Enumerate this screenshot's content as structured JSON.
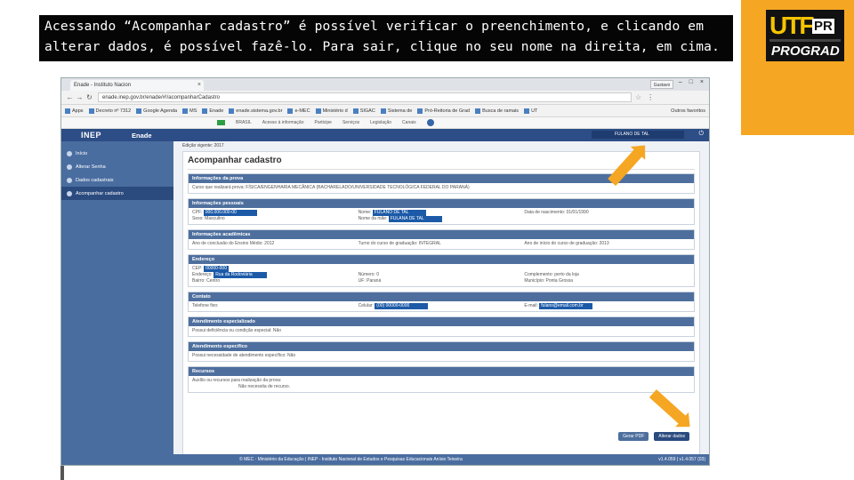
{
  "slide": {
    "caption": "Acessando “Acompanhar cadastro” é possível verificar o preenchimento, e clicando em alterar dados, é possível fazê-lo. Para sair, clique no seu nome na direita, em cima.",
    "logo_text": "UTF",
    "logo_pr": "PR",
    "prograd": "PROGRAD",
    "accent_color": "#f5a623"
  },
  "browser": {
    "tab_title": "Enade - Instituto Nacion",
    "user_chip": "Gustavo",
    "window_controls": "– □ ×",
    "url": "enade.inep.gov.br/enade/#!/acompanharCadastro",
    "bookmarks": [
      "Apps",
      "Decreto nº 7312",
      "Google Agenda",
      "MS",
      "Enade",
      "enade.sistema.gov.br",
      "e-MEC",
      "Ministério d",
      "SIGAC",
      "Sistema de",
      "Pró-Reitoria de Grad",
      "Busca de ramais",
      "UT"
    ],
    "bookmarks_right": "Outros favoritos"
  },
  "gov_bar": {
    "country": "BRASIL",
    "links": [
      "Acesso à informação",
      "Participe",
      "Serviços",
      "Legislação",
      "Canais"
    ]
  },
  "app": {
    "logo": "INEP",
    "module": "Enade",
    "user_name": "FULANO DE TAL",
    "sidebar": [
      {
        "label": "Início",
        "icon": "home-icon"
      },
      {
        "label": "Alterar Senha",
        "icon": "key-icon"
      },
      {
        "label": "Dados cadastrais",
        "icon": "user-icon"
      },
      {
        "label": "Acompanhar cadastro",
        "icon": "check-icon"
      }
    ],
    "edition": "Edição vigente: 2017",
    "page_title": "Acompanhar cadastro"
  },
  "panels": {
    "prova": {
      "title": "Informações da prova",
      "line": "Curso que realizará prova: FÍSICA/ENGENHARIA MECÂNICA (BACHARELADO/UNIVERSIDADE TECNOLÓGICA FEDERAL DO PARANÁ)"
    },
    "pessoais": {
      "title": "Informações pessoais",
      "cpf_label": "CPF:",
      "cpf_value": "000.000.000-00",
      "sexo": "Sexo: Masculino",
      "nome_label": "Nome:",
      "nome_value": "FULANO DE TAL",
      "nome_social_label": "Nome da mãe:",
      "nome_social_value": "FULANA DE TAL",
      "nascimento": "Data de nascimento: 01/01/1990"
    },
    "academicas": {
      "title": "Informações acadêmicas",
      "ano": "Ano de conclusão do Ensino Médio: 2012",
      "turno": "Turno do curso de graduação: INTEGRAL",
      "inicio": "Ano de início do curso de graduação: 2013"
    },
    "endereco": {
      "title": "Endereço",
      "cep_label": "CEP:",
      "cep_value": "00000-000",
      "logradouro_label": "Endereço:",
      "logradouro_value": "Rua da Rodoviária",
      "bairro": "Bairro: Centro",
      "numero": "Número: 0",
      "uf": "UF: Paraná",
      "complemento": "Complemento: perto da loja",
      "municipio": "Município: Ponta Grossa"
    },
    "contato": {
      "title": "Contato",
      "telefone": "Telefone fixo:",
      "celular_label": "Celular:",
      "celular_value": "(00) 00000-0000",
      "email_label": "E-mail:",
      "email_value": "fulano@email.com.br"
    },
    "especializado": {
      "title": "Atendimento especializado",
      "line": "Possui deficiência ou condição especial: Não"
    },
    "especifico": {
      "title": "Atendimento específico",
      "line": "Possui necessidade de atendimento específico: Não"
    },
    "recursos": {
      "title": "Recursos",
      "line1": "Auxílio ou recursos para realização da prova:",
      "line2": "Não necessita de recurso."
    }
  },
  "buttons": {
    "primary": "Gerar PDF",
    "alter": "Alterar dados"
  },
  "footer": {
    "text": "© MEC - Ministério da Educação | INEP - Instituto Nacional de Estudos e Pesquisas Educacionais Anísio Teixeira",
    "version": "v1.4.059 | v1.4.057 (03)"
  }
}
